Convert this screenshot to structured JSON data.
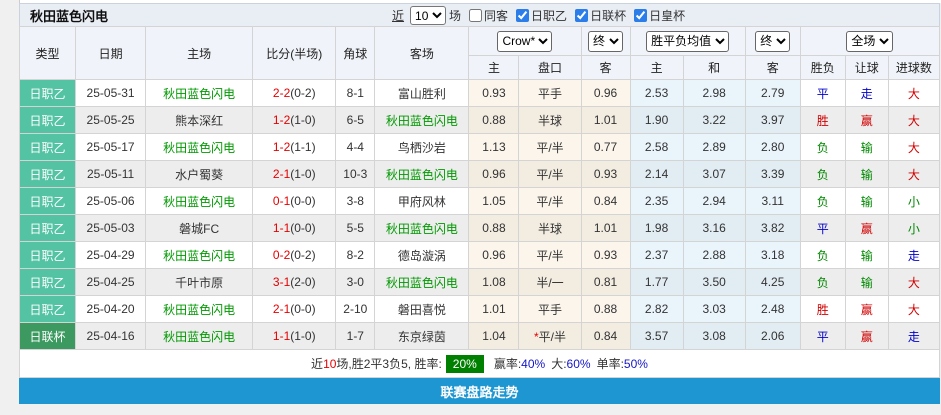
{
  "header": {
    "title": "秋田蓝色闪电",
    "recent_label": "近",
    "recent_value": "10",
    "matches_label": "场",
    "checkboxes": [
      {
        "label": "同客",
        "checked": false
      },
      {
        "label": "日职乙",
        "checked": true
      },
      {
        "label": "日联杯",
        "checked": true
      },
      {
        "label": "日皇杯",
        "checked": true
      }
    ]
  },
  "table": {
    "selects": {
      "company": "Crow*",
      "asia_time": "终",
      "europe": "胜平负均值",
      "europe_time": "终",
      "scope": "全场"
    },
    "columns": {
      "type": "类型",
      "date": "日期",
      "home": "主场",
      "score": "比分(半场)",
      "corner": "角球",
      "away": "客场",
      "asia_home": "主",
      "handicap": "盘口",
      "asia_away": "客",
      "eu_home": "主",
      "eu_draw": "和",
      "eu_away": "客",
      "result": "胜负",
      "let_ball": "让球",
      "goals": "进球数"
    },
    "rows": [
      {
        "type": "日职乙",
        "cup": false,
        "date": "25-05-31",
        "home": "秋田蓝色闪电",
        "home_self": true,
        "score": "2-2",
        "half": "(0-2)",
        "corner": "8-1",
        "away": "富山胜利",
        "away_self": false,
        "hstar": "",
        "ah": "0.93",
        "hcap": "平手",
        "aa": "0.96",
        "eh": "2.53",
        "ed": "2.98",
        "ea": "2.79",
        "res": "平",
        "res_c": "blue",
        "let": "走",
        "let_c": "blue",
        "goal": "大",
        "goal_c": "red"
      },
      {
        "type": "日职乙",
        "cup": false,
        "date": "25-05-25",
        "home": "熊本深红",
        "home_self": false,
        "score": "1-2",
        "half": "(1-0)",
        "corner": "6-5",
        "away": "秋田蓝色闪电",
        "away_self": true,
        "hstar": "",
        "ah": "0.88",
        "hcap": "半球",
        "aa": "1.01",
        "eh": "1.90",
        "ed": "3.22",
        "ea": "3.97",
        "res": "胜",
        "res_c": "red",
        "let": "赢",
        "let_c": "red",
        "goal": "大",
        "goal_c": "red"
      },
      {
        "type": "日职乙",
        "cup": false,
        "date": "25-05-17",
        "home": "秋田蓝色闪电",
        "home_self": true,
        "score": "1-2",
        "half": "(1-1)",
        "corner": "4-4",
        "away": "鸟栖沙岩",
        "away_self": false,
        "hstar": "",
        "ah": "1.13",
        "hcap": "平/半",
        "aa": "0.77",
        "eh": "2.58",
        "ed": "2.89",
        "ea": "2.80",
        "res": "负",
        "res_c": "green",
        "let": "输",
        "let_c": "green",
        "goal": "大",
        "goal_c": "red"
      },
      {
        "type": "日职乙",
        "cup": false,
        "date": "25-05-11",
        "home": "水户蜀葵",
        "home_self": false,
        "score": "2-1",
        "half": "(1-0)",
        "corner": "10-3",
        "away": "秋田蓝色闪电",
        "away_self": true,
        "hstar": "",
        "ah": "0.96",
        "hcap": "平/半",
        "aa": "0.93",
        "eh": "2.14",
        "ed": "3.07",
        "ea": "3.39",
        "res": "负",
        "res_c": "green",
        "let": "输",
        "let_c": "green",
        "goal": "大",
        "goal_c": "red"
      },
      {
        "type": "日职乙",
        "cup": false,
        "date": "25-05-06",
        "home": "秋田蓝色闪电",
        "home_self": true,
        "score": "0-1",
        "half": "(0-0)",
        "corner": "3-8",
        "away": "甲府风林",
        "away_self": false,
        "hstar": "",
        "ah": "1.05",
        "hcap": "平/半",
        "aa": "0.84",
        "eh": "2.35",
        "ed": "2.94",
        "ea": "3.11",
        "res": "负",
        "res_c": "green",
        "let": "输",
        "let_c": "green",
        "goal": "小",
        "goal_c": "green"
      },
      {
        "type": "日职乙",
        "cup": false,
        "date": "25-05-03",
        "home": "磐城FC",
        "home_self": false,
        "score": "1-1",
        "half": "(0-0)",
        "corner": "5-5",
        "away": "秋田蓝色闪电",
        "away_self": true,
        "hstar": "",
        "ah": "0.88",
        "hcap": "半球",
        "aa": "1.01",
        "eh": "1.98",
        "ed": "3.16",
        "ea": "3.82",
        "res": "平",
        "res_c": "blue",
        "let": "赢",
        "let_c": "red",
        "goal": "小",
        "goal_c": "green"
      },
      {
        "type": "日职乙",
        "cup": false,
        "date": "25-04-29",
        "home": "秋田蓝色闪电",
        "home_self": true,
        "score": "0-2",
        "half": "(0-2)",
        "corner": "8-2",
        "away": "德岛漩涡",
        "away_self": false,
        "hstar": "",
        "ah": "0.96",
        "hcap": "平/半",
        "aa": "0.93",
        "eh": "2.37",
        "ed": "2.88",
        "ea": "3.18",
        "res": "负",
        "res_c": "green",
        "let": "输",
        "let_c": "green",
        "goal": "走",
        "goal_c": "blue"
      },
      {
        "type": "日职乙",
        "cup": false,
        "date": "25-04-25",
        "home": "千叶市原",
        "home_self": false,
        "score": "3-1",
        "half": "(2-0)",
        "corner": "3-0",
        "away": "秋田蓝色闪电",
        "away_self": true,
        "hstar": "",
        "ah": "1.08",
        "hcap": "半/一",
        "aa": "0.81",
        "eh": "1.77",
        "ed": "3.50",
        "ea": "4.25",
        "res": "负",
        "res_c": "green",
        "let": "输",
        "let_c": "green",
        "goal": "大",
        "goal_c": "red"
      },
      {
        "type": "日职乙",
        "cup": false,
        "date": "25-04-20",
        "home": "秋田蓝色闪电",
        "home_self": true,
        "score": "2-1",
        "half": "(0-0)",
        "corner": "2-10",
        "away": "磐田喜悦",
        "away_self": false,
        "hstar": "",
        "ah": "1.01",
        "hcap": "平手",
        "aa": "0.88",
        "eh": "2.82",
        "ed": "3.03",
        "ea": "2.48",
        "res": "胜",
        "res_c": "red",
        "let": "赢",
        "let_c": "red",
        "goal": "大",
        "goal_c": "red"
      },
      {
        "type": "日联杯",
        "cup": true,
        "date": "25-04-16",
        "home": "秋田蓝色闪电",
        "home_self": true,
        "score": "1-1",
        "half": "(1-0)",
        "corner": "1-7",
        "away": "东京绿茵",
        "away_self": false,
        "hstar": "*",
        "ah": "1.04",
        "hcap": "平/半",
        "aa": "0.84",
        "eh": "3.57",
        "ed": "3.08",
        "ea": "2.06",
        "res": "平",
        "res_c": "blue",
        "let": "赢",
        "let_c": "red",
        "goal": "走",
        "goal_c": "blue"
      }
    ]
  },
  "summary": {
    "prefix": "近",
    "count": "10",
    "mid": "场,胜2平3负5, 胜率:",
    "win_rate": "20%",
    "label_win": "赢率:",
    "val_win": "40%",
    "label_big": "大:",
    "val_big": "60%",
    "label_single": "单率:",
    "val_single": "50%"
  },
  "bottom_bar": {
    "label": "联赛盘路走势"
  },
  "colors": {
    "league_badge": "#54c3a4",
    "cup_badge": "#3c9a61",
    "team_self": "#009900",
    "score_red": "#e60000",
    "result_red": "#d10000",
    "result_blue": "#0000cc",
    "result_green": "#008800",
    "asia_bg": "#fbf5ec",
    "europe_bg": "#eaf4fb",
    "bottom_bar_bg": "#1e96d2",
    "win_rate_badge_bg": "#008000"
  }
}
